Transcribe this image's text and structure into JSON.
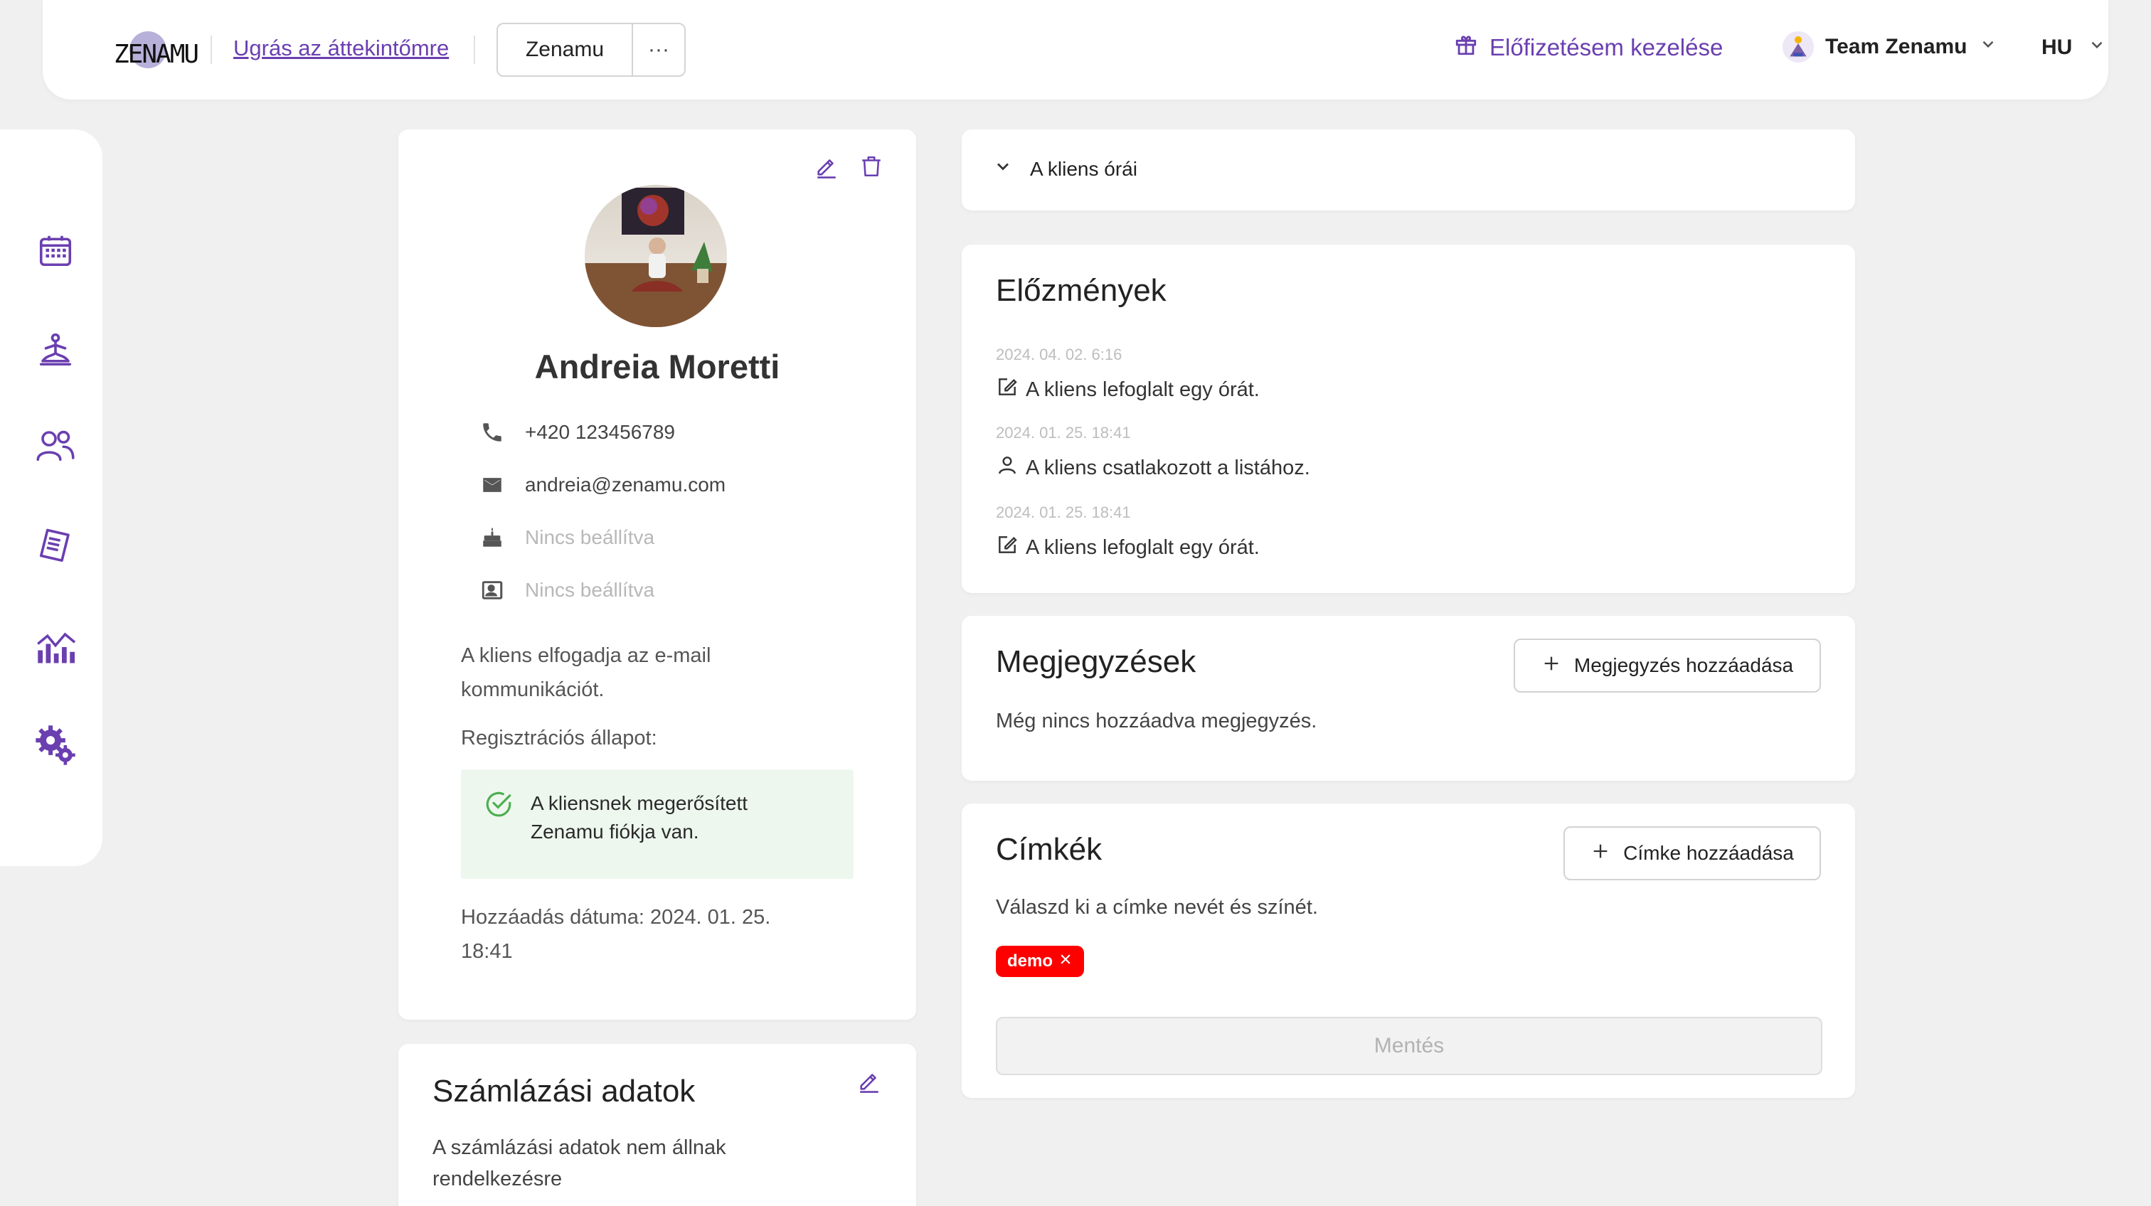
{
  "header": {
    "logo_text": "ZENAMU",
    "jump_link": "Ugrás az áttekintőmre",
    "studio_button": "Zenamu",
    "more_button": "···",
    "subscription_link": "Előfizetésem kezelése",
    "team_name": "Team Zenamu",
    "language": "HU"
  },
  "sidebar": {
    "items": [
      "calendar-icon",
      "yoga-icon",
      "clients-icon",
      "invoices-icon",
      "statistics-icon",
      "settings-icon"
    ]
  },
  "profile": {
    "name": "Andreia Moretti",
    "phone": "+420 123456789",
    "email": "andreia@zenamu.com",
    "birthday": "Nincs beállítva",
    "id_card": "Nincs beállítva",
    "email_consent_line1": "A kliens elfogadja az e-mail",
    "email_consent_line2": "kommunikációt.",
    "registration_label": "Regisztrációs állapot:",
    "registration_status_line1": "A kliensnek megerősített",
    "registration_status_line2": "Zenamu fiókja van.",
    "added_date_line1": "Hozzáadás dátuma: 2024. 01. 25.",
    "added_date_line2": "18:41"
  },
  "billing": {
    "title": "Számlázási adatok",
    "text_line1": "A számlázási adatok nem állnak",
    "text_line2": "rendelkezésre"
  },
  "classes": {
    "title": "A kliens órái"
  },
  "history": {
    "title": "Előzmények",
    "entries": [
      {
        "time": "2024. 04. 02. 6:16",
        "message": "A kliens lefoglalt egy órát."
      },
      {
        "time": "2024. 01. 25. 18:41",
        "message": "A kliens csatlakozott a listához."
      },
      {
        "time": "2024. 01. 25. 18:41",
        "message": "A kliens lefoglalt egy órát."
      }
    ]
  },
  "notes": {
    "title": "Megjegyzések",
    "add_button": "Megjegyzés hozzáadása",
    "empty_text": "Még nincs hozzáadva megjegyzés."
  },
  "tags": {
    "title": "Címkék",
    "add_button": "Címke hozzáadása",
    "hint": "Válaszd ki a címke nevét és színét.",
    "items": [
      {
        "label": "demo",
        "color": "#ff0000"
      }
    ],
    "save_button": "Mentés"
  },
  "colors": {
    "accent": "#6a3fb0",
    "success": "#4caf50",
    "tag_red": "#ff0000"
  }
}
